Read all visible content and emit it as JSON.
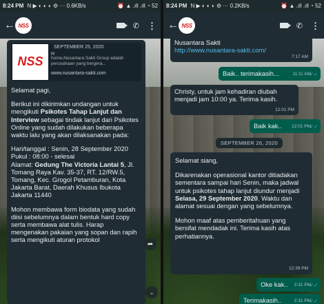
{
  "left": {
    "status": {
      "time": "8:24 PM",
      "icons": "N ▶ ◐ ◐ ◐ ⚙ ···",
      "speed": "0.6KB/s",
      "right": "⏰ ▲ .ıll .ıll ◔ 52"
    },
    "contact_logo": "NSS",
    "preview": {
      "logo": "NSS",
      "date": "SEPTEMBER 25, 2020",
      "title": "H",
      "desc": "home,Nusantara Sakti Group adalah perusahaan yang bergera...",
      "url": "www.nusantara-sakti.com"
    },
    "message": {
      "p1": "Selamat pagi,",
      "p2_a": "Berikut ini dikirimkan undangan untuk mengikuti ",
      "p2_b": "Psikotes Tahap Lanjut dan Interview",
      "p2_c": " sebagai tindak lanjut dari Psikotes Online yang sudah dilakukan beberapa waktu lalu yang akan dilaksanakan pada:",
      "p3_a": "Hari/tanggal : Senin, 28 September 2020",
      "p3_b": "Pukul : 08:00 - selesai",
      "p3_c": "Alamat: ",
      "p3_d": "Gedung The Victoria Lantai 5",
      "p3_e": ", Jl. Tomang Raya Kav. 35-37, RT. 12/RW.5, Tomang, Kec. Grogol Petamburan, Kota Jakarta Barat, Daerah Khusus Ibukota Jakarta 11440",
      "p4": "Mohon membawa form biodata yang sudah diisi sebelumnya dalam bentuk hard copy serta membawa alat tulis. Harap mengenakan pakaian yang sopan dan rapih serta mengikuti aturan protokol"
    }
  },
  "right": {
    "status": {
      "time": "8:24 PM",
      "icons": "N ▶ ◐ ◐ ◐ ⚙ ···",
      "speed": "0.2KB/s",
      "right": "⏰ ▲ .ıll .ıll ◔ 52"
    },
    "contact_logo": "NSS",
    "m0": {
      "name": "Nusantara Sakti",
      "url": "http://www.nusantara-sakti.com/",
      "time": "7:17 AM"
    },
    "m1": {
      "text": "Baik.. terimakasih...",
      "time": "11:11 AM"
    },
    "m2": {
      "text": "Christy, untuk jam kehadiran diubah menjadi jam 10:00 ya. Terima kasih.",
      "time": "12:01 PM"
    },
    "m3": {
      "text": "Baik kak..",
      "time": "12:01 PM"
    },
    "date_chip": "SEPTEMBER 26, 2020",
    "m4": {
      "p1": "Selamat siang,",
      "p2_a": "Dikarenakan operasional kantor ditiadakan sementara sampai hari Senin, maka jadwal untuk psikotes tahap lanjut diundur menjadi ",
      "p2_b": "Selasa, 29 September 2020",
      "p2_c": ". Waktu dan alamat sesuai dengan yang sebelumnya.",
      "p3": "Mohon maaf atas pemberitahuan yang bersifat mendadak ini. Terima kasih atas perhatiannya.",
      "time": "12:39 PM"
    },
    "m5": {
      "text": "Oke kak..",
      "time": "2:31 PM"
    },
    "m6": {
      "text": "Terimakasih..",
      "time": "2:31 PM"
    }
  }
}
